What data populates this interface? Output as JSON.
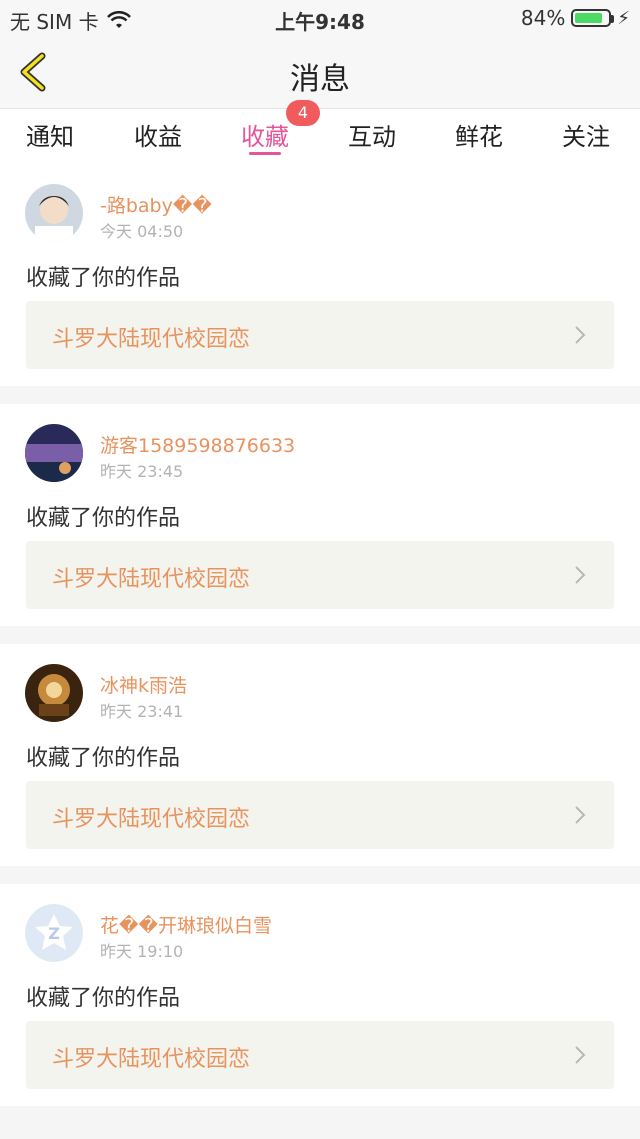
{
  "status_bar": {
    "carrier": "无 SIM 卡",
    "time": "上午9:48",
    "battery": "84%"
  },
  "nav": {
    "title": "消息"
  },
  "tabs": [
    {
      "label": "通知"
    },
    {
      "label": "收益"
    },
    {
      "label": "收藏"
    },
    {
      "label": "互动"
    },
    {
      "label": "鲜花"
    },
    {
      "label": "关注"
    }
  ],
  "tab_badge": "4",
  "notifications": [
    {
      "user": "-路baby��",
      "time": "今天 04:50",
      "action": "收藏了你的作品",
      "work": "斗罗大陆现代校园恋"
    },
    {
      "user": "游客1589598876633",
      "time": "昨天 23:45",
      "action": "收藏了你的作品",
      "work": "斗罗大陆现代校园恋"
    },
    {
      "user": "冰神k雨浩",
      "time": "昨天 23:41",
      "action": "收藏了你的作品",
      "work": "斗罗大陆现代校园恋"
    },
    {
      "user": "花��开琳琅似白雪",
      "time": "昨天 19:10",
      "action": "收藏了你的作品",
      "work": "斗罗大陆现代校园恋"
    }
  ],
  "colors": {
    "accent_pink": "#e4569a",
    "username_orange": "#e8935e",
    "badge_red": "#f25b5e"
  }
}
